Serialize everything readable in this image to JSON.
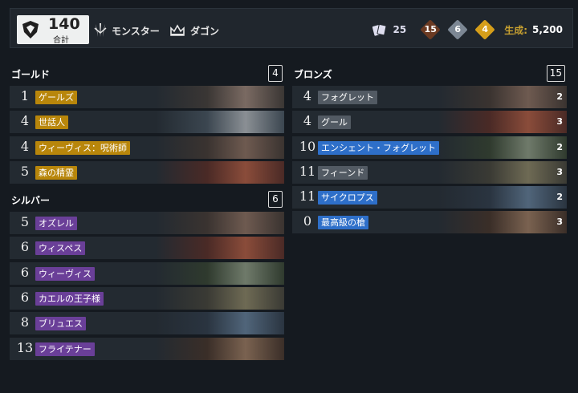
{
  "header": {
    "total_value": "140",
    "total_label": "合計",
    "faction_label": "モンスター",
    "leader_label": "ダゴン",
    "card_count": "25",
    "bronze_count": "15",
    "silver_count": "6",
    "gold_count": "4",
    "production_label": "生成:",
    "production_value": "5,200"
  },
  "colors": {
    "gold": "#b8860b",
    "silver": "#6a3f98",
    "bronze_grey": "#525a63",
    "bronze_blue": "#2e6fc9",
    "bronze_diamond": "#6b3a22",
    "silver_diamond": "#7c8794",
    "gold_diamond": "#d59e1a"
  },
  "gold_section": {
    "title": "ゴールド",
    "count": "4",
    "cards": [
      {
        "cost": "1",
        "name": "ゲールズ"
      },
      {
        "cost": "4",
        "name": "世話人"
      },
      {
        "cost": "4",
        "name": "ウィーヴィス：呪術師"
      },
      {
        "cost": "5",
        "name": "森の精霊"
      }
    ]
  },
  "silver_section": {
    "title": "シルバー",
    "count": "6",
    "cards": [
      {
        "cost": "5",
        "name": "オズレル"
      },
      {
        "cost": "6",
        "name": "ウィスペス"
      },
      {
        "cost": "6",
        "name": "ウィーヴィス"
      },
      {
        "cost": "6",
        "name": "カエルの王子様"
      },
      {
        "cost": "8",
        "name": "ブリュエス"
      },
      {
        "cost": "13",
        "name": "フライテナー"
      }
    ]
  },
  "bronze_section": {
    "title": "ブロンズ",
    "count": "15",
    "cards": [
      {
        "cost": "4",
        "name": "フォグレット",
        "copies": "2"
      },
      {
        "cost": "4",
        "name": "グール",
        "copies": "3"
      },
      {
        "cost": "10",
        "name": "エンシェント・フォグレット",
        "copies": "2"
      },
      {
        "cost": "11",
        "name": "フィーンド",
        "copies": "3"
      },
      {
        "cost": "11",
        "name": "サイクロプス",
        "copies": "2"
      },
      {
        "cost": "0",
        "name": "最高級の槍",
        "copies": "3"
      }
    ]
  }
}
